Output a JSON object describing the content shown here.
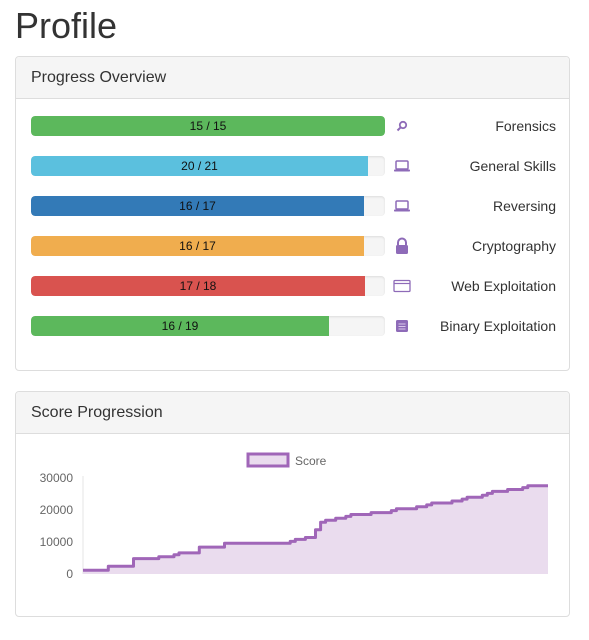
{
  "page": {
    "title": "Profile"
  },
  "progress_panel": {
    "heading": "Progress Overview",
    "rows": [
      {
        "label": "Forensics",
        "solved": 15,
        "total": 15,
        "text": "15 / 15",
        "color": "#5cb85c",
        "icon": "magnifier-icon"
      },
      {
        "label": "General Skills",
        "solved": 20,
        "total": 21,
        "text": "20 / 21",
        "color": "#5bc0de",
        "icon": "laptop-icon"
      },
      {
        "label": "Reversing",
        "solved": 16,
        "total": 17,
        "text": "16 / 17",
        "color": "#337ab7",
        "icon": "laptop-icon"
      },
      {
        "label": "Cryptography",
        "solved": 16,
        "total": 17,
        "text": "16 / 17",
        "color": "#f0ad4e",
        "icon": "lock-icon"
      },
      {
        "label": "Web Exploitation",
        "solved": 17,
        "total": 18,
        "text": "17 / 18",
        "color": "#d9534f",
        "icon": "browser-window-icon"
      },
      {
        "label": "Binary Exploitation",
        "solved": 16,
        "total": 19,
        "text": "16 / 19",
        "color": "#5cb85c",
        "icon": "binary-chip-icon"
      }
    ]
  },
  "score_panel": {
    "heading": "Score Progression",
    "chart_data": {
      "type": "area",
      "series": [
        {
          "name": "Score",
          "stroke": "#a066b8",
          "fill": "#eadcee",
          "values": [
            1200,
            1200,
            1200,
            1200,
            1200,
            2400,
            2400,
            2400,
            2400,
            2400,
            4800,
            4800,
            4800,
            4800,
            4800,
            5400,
            5400,
            5400,
            6000,
            6600,
            6600,
            6600,
            6600,
            8400,
            8400,
            8400,
            8400,
            8400,
            9600,
            9600,
            9600,
            9600,
            9600,
            9600,
            9600,
            9600,
            9600,
            9600,
            9600,
            9600,
            9600,
            10200,
            10800,
            10800,
            11400,
            11400,
            13800,
            16200,
            16800,
            16800,
            17400,
            17400,
            18000,
            18600,
            18600,
            18600,
            18600,
            19200,
            19200,
            19200,
            19200,
            19800,
            20400,
            20400,
            20400,
            20400,
            21000,
            21000,
            21600,
            22200,
            22200,
            22200,
            22200,
            22800,
            22800,
            23400,
            24000,
            24000,
            24000,
            24600,
            25200,
            25800,
            25800,
            25800,
            26400,
            26400,
            26400,
            27000,
            27600,
            27600,
            27600,
            27600,
            27600
          ]
        }
      ],
      "y_ticks": [
        "0",
        "10000",
        "20000",
        "30000"
      ],
      "ylim": [
        0,
        30000
      ],
      "grid": false,
      "legend": "top-center"
    }
  }
}
